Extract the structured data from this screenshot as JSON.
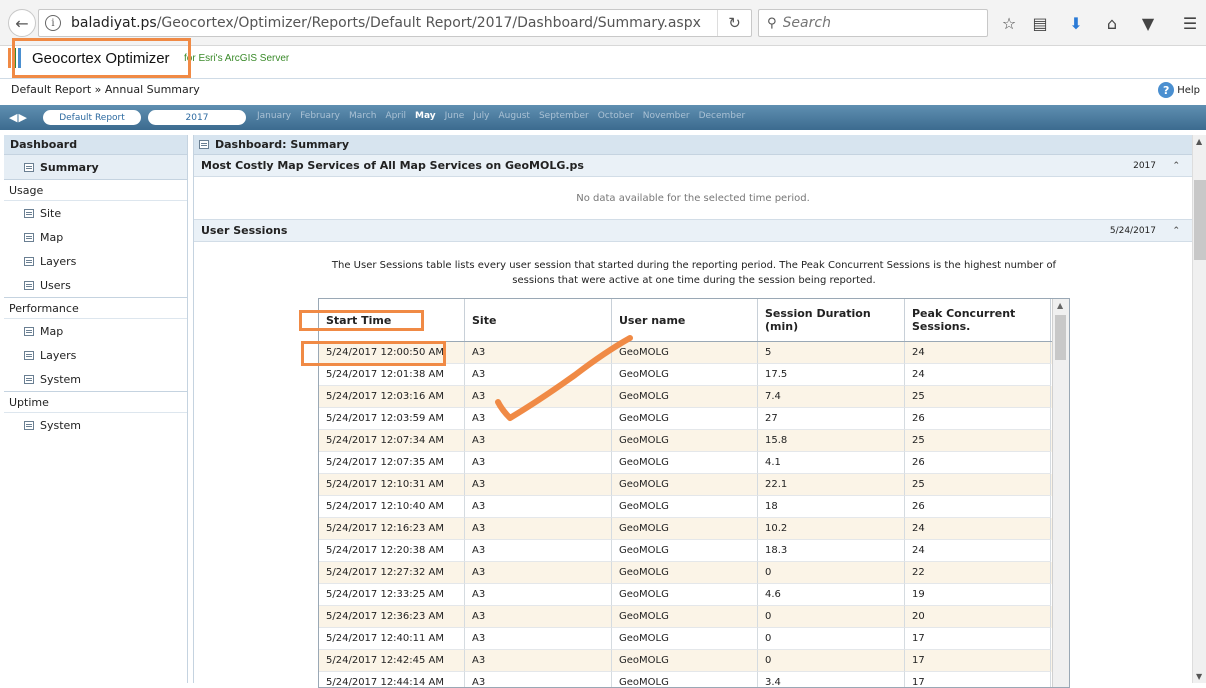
{
  "browser": {
    "url_host": "baladiyat.ps",
    "url_path": "/Geocortex/Optimizer/Reports/Default Report/2017/Dashboard/Summary.aspx",
    "search_placeholder": "Search"
  },
  "app": {
    "logo_title": "Geocortex Optimizer",
    "logo_subtitle": "for Esri's ArcGIS Server",
    "logo_colors": [
      "#f08a45",
      "#3a8a2a",
      "#4a8fd0"
    ]
  },
  "breadcrumb": {
    "root": "Default Report",
    "separator": "»",
    "current": "Annual Summary"
  },
  "help_label": "Help",
  "period": {
    "report_label": "Default Report",
    "year_label": "2017",
    "months": [
      "January",
      "February",
      "March",
      "April",
      "May",
      "June",
      "July",
      "August",
      "September",
      "October",
      "November",
      "December"
    ],
    "active_month": "May"
  },
  "sidebar": {
    "dashboard": "Dashboard",
    "summary": "Summary",
    "usage": "Usage",
    "usage_items": [
      "Site",
      "Map",
      "Layers",
      "Users"
    ],
    "performance": "Performance",
    "performance_items": [
      "Map",
      "Layers",
      "System"
    ],
    "uptime": "Uptime",
    "uptime_items": [
      "System"
    ]
  },
  "main": {
    "title": "Dashboard: Summary",
    "panel1_title": "Most Costly Map Services of All Map Services on GeoMOLG.ps",
    "panel1_date": "2017",
    "panel1_empty": "No data available for the selected time period.",
    "panel2_title": "User Sessions",
    "panel2_date": "5/24/2017",
    "description": "The User Sessions table lists every user session that started during the reporting period. The Peak Concurrent Sessions is the highest number of sessions that were active at one time during the session being reported."
  },
  "table": {
    "headers": [
      "Start Time",
      "Site",
      "User name",
      "Session Duration (min)",
      "Peak Concurrent Sessions."
    ],
    "rows": [
      [
        "5/24/2017 12:00:50 AM",
        "A3",
        "GeoMOLG",
        "5",
        "24"
      ],
      [
        "5/24/2017 12:01:38 AM",
        "A3",
        "GeoMOLG",
        "17.5",
        "24"
      ],
      [
        "5/24/2017 12:03:16 AM",
        "A3",
        "GeoMOLG",
        "7.4",
        "25"
      ],
      [
        "5/24/2017 12:03:59 AM",
        "A3",
        "GeoMOLG",
        "27",
        "26"
      ],
      [
        "5/24/2017 12:07:34 AM",
        "A3",
        "GeoMOLG",
        "15.8",
        "25"
      ],
      [
        "5/24/2017 12:07:35 AM",
        "A3",
        "GeoMOLG",
        "4.1",
        "26"
      ],
      [
        "5/24/2017 12:10:31 AM",
        "A3",
        "GeoMOLG",
        "22.1",
        "25"
      ],
      [
        "5/24/2017 12:10:40 AM",
        "A3",
        "GeoMOLG",
        "18",
        "26"
      ],
      [
        "5/24/2017 12:16:23 AM",
        "A3",
        "GeoMOLG",
        "10.2",
        "24"
      ],
      [
        "5/24/2017 12:20:38 AM",
        "A3",
        "GeoMOLG",
        "18.3",
        "24"
      ],
      [
        "5/24/2017 12:27:32 AM",
        "A3",
        "GeoMOLG",
        "0",
        "22"
      ],
      [
        "5/24/2017 12:33:25 AM",
        "A3",
        "GeoMOLG",
        "4.6",
        "19"
      ],
      [
        "5/24/2017 12:36:23 AM",
        "A3",
        "GeoMOLG",
        "0",
        "20"
      ],
      [
        "5/24/2017 12:40:11 AM",
        "A3",
        "GeoMOLG",
        "0",
        "17"
      ],
      [
        "5/24/2017 12:42:45 AM",
        "A3",
        "GeoMOLG",
        "0",
        "17"
      ],
      [
        "5/24/2017 12:44:14 AM",
        "A3",
        "GeoMOLG",
        "3.4",
        "17"
      ]
    ]
  },
  "annotation_color": "#f08a45"
}
